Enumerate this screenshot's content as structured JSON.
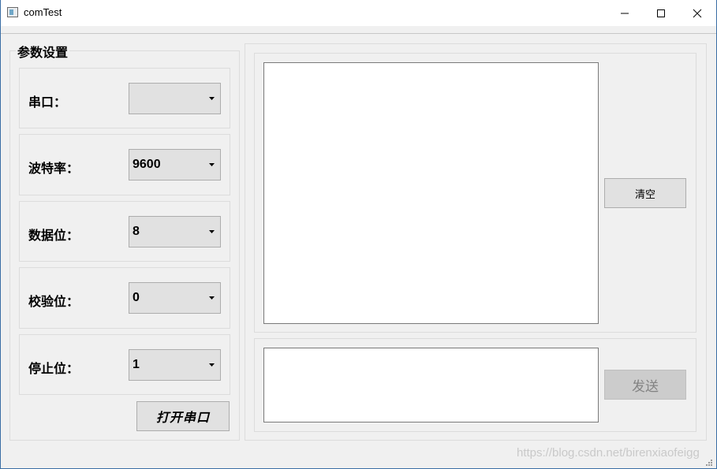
{
  "window": {
    "title": "comTest",
    "controls": {
      "minimize": "minimize",
      "maximize": "maximize",
      "close": "close"
    }
  },
  "settings": {
    "group_title": "参数设置",
    "rows": [
      {
        "label": "串口：",
        "value": ""
      },
      {
        "label": "波特率：",
        "value": "9600"
      },
      {
        "label": "数据位：",
        "value": "8"
      },
      {
        "label": "校验位：",
        "value": "0"
      },
      {
        "label": "停止位：",
        "value": "1"
      }
    ],
    "open_button": "打开串口"
  },
  "receive": {
    "clear_button": "清空",
    "text": ""
  },
  "send": {
    "send_button": "发送",
    "text": ""
  },
  "watermark": "https://blog.csdn.net/birenxiaofeigg",
  "colors": {
    "titlebar": "#ffffff",
    "background": "#f0f0f0",
    "button": "#e1e1e1",
    "button_disabled": "#cccccc",
    "frame_accent": "#3a6ea5"
  }
}
